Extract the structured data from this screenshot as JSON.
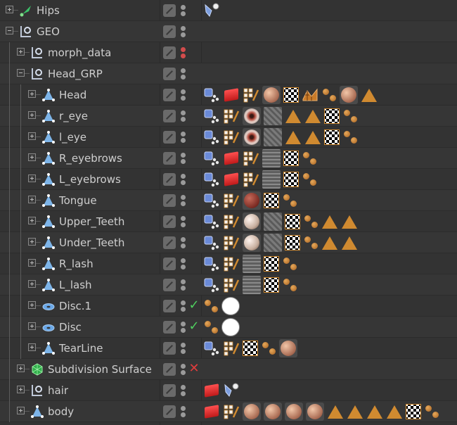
{
  "panel": "object-manager",
  "rows": [
    {
      "label": "Hips",
      "icon": "joint-icon",
      "depth": 0,
      "expander": "plus",
      "vis": "gray",
      "status": "",
      "tags": [
        "pose-morph-tag"
      ]
    },
    {
      "label": "GEO",
      "icon": "null-object-icon",
      "depth": 0,
      "expander": "minus",
      "vis": "gray",
      "status": "",
      "tags": []
    },
    {
      "label": "morph_data",
      "icon": "null-object-icon",
      "depth": 1,
      "expander": "plus",
      "vis": "red",
      "status": "",
      "tags": []
    },
    {
      "label": "Head_GRP",
      "icon": "null-object-icon",
      "depth": 1,
      "expander": "minus",
      "vis": "gray",
      "status": "",
      "tags": []
    },
    {
      "label": "Head",
      "icon": "polygon-object-icon",
      "depth": 2,
      "expander": "plus",
      "vis": "gray",
      "status": "",
      "tags": [
        "xpresso-tag",
        "selection-tag",
        "uvw-tag",
        "material-skin",
        "material-checker",
        "weight-tag",
        "dots-tag",
        "material-skin",
        "triangle-tag"
      ]
    },
    {
      "label": "r_eye",
      "icon": "polygon-object-icon",
      "depth": 2,
      "expander": "plus",
      "vis": "gray",
      "status": "",
      "tags": [
        "xpresso-tag",
        "uvw-tag",
        "material-eye",
        "material-tex",
        "triangle-tag",
        "triangle-tag",
        "material-checker",
        "dots-tag"
      ]
    },
    {
      "label": "l_eye",
      "icon": "polygon-object-icon",
      "depth": 2,
      "expander": "plus",
      "vis": "gray",
      "status": "",
      "tags": [
        "xpresso-tag",
        "uvw-tag",
        "material-eye",
        "material-tex",
        "triangle-tag",
        "triangle-tag",
        "material-checker",
        "dots-tag"
      ]
    },
    {
      "label": "R_eyebrows",
      "icon": "polygon-object-icon",
      "depth": 2,
      "expander": "plus",
      "vis": "gray",
      "status": "",
      "tags": [
        "xpresso-tag",
        "selection-tag",
        "uvw-tag",
        "material-tex2",
        "material-checker",
        "dots-tag"
      ]
    },
    {
      "label": "L_eyebrows",
      "icon": "polygon-object-icon",
      "depth": 2,
      "expander": "plus",
      "vis": "gray",
      "status": "",
      "tags": [
        "xpresso-tag",
        "selection-tag",
        "uvw-tag",
        "material-tex2",
        "material-checker",
        "dots-tag"
      ]
    },
    {
      "label": "Tongue",
      "icon": "polygon-object-icon",
      "depth": 2,
      "expander": "plus",
      "vis": "gray",
      "status": "",
      "tags": [
        "xpresso-tag",
        "uvw-tag",
        "material-red",
        "material-checker",
        "dots-tag"
      ]
    },
    {
      "label": "Upper_Teeth",
      "icon": "polygon-object-icon",
      "depth": 2,
      "expander": "plus",
      "vis": "gray",
      "status": "",
      "tags": [
        "xpresso-tag",
        "uvw-tag",
        "material-teeth",
        "material-tex",
        "material-checker",
        "dots-tag",
        "triangle-tag",
        "triangle-tag"
      ]
    },
    {
      "label": "Under_Teeth",
      "icon": "polygon-object-icon",
      "depth": 2,
      "expander": "plus",
      "vis": "gray",
      "status": "",
      "tags": [
        "xpresso-tag",
        "uvw-tag",
        "material-teeth",
        "material-tex",
        "material-checker",
        "dots-tag",
        "triangle-tag",
        "triangle-tag"
      ]
    },
    {
      "label": "R_lash",
      "icon": "polygon-object-icon",
      "depth": 2,
      "expander": "plus",
      "vis": "gray",
      "status": "",
      "tags": [
        "xpresso-tag",
        "uvw-tag",
        "material-tex2",
        "material-checker",
        "dots-tag"
      ]
    },
    {
      "label": "L_lash",
      "icon": "polygon-object-icon",
      "depth": 2,
      "expander": "plus",
      "vis": "gray",
      "status": "",
      "tags": [
        "xpresso-tag",
        "uvw-tag",
        "material-tex2",
        "material-checker",
        "dots-tag"
      ]
    },
    {
      "label": "Disc.1",
      "icon": "disc-icon",
      "depth": 2,
      "expander": "plus",
      "vis": "gray",
      "status": "check",
      "tags": [
        "dots-tag",
        "material-white"
      ]
    },
    {
      "label": "Disc",
      "icon": "disc-icon",
      "depth": 2,
      "expander": "plus",
      "vis": "gray",
      "status": "check",
      "tags": [
        "dots-tag",
        "material-white"
      ]
    },
    {
      "label": "TearLine",
      "icon": "polygon-object-icon",
      "depth": 2,
      "expander": "plus",
      "vis": "gray",
      "status": "",
      "tags": [
        "xpresso-tag",
        "uvw-tag",
        "material-checker",
        "dots-tag",
        "material-skin"
      ]
    },
    {
      "label": "Subdivision Surface",
      "icon": "subdivision-surface-icon",
      "depth": 1,
      "expander": "plus",
      "vis": "gray",
      "status": "x",
      "tags": []
    },
    {
      "label": "hair",
      "icon": "null-object-icon",
      "depth": 1,
      "expander": "plus",
      "vis": "gray",
      "status": "",
      "tags": [
        "selection-tag",
        "pose-morph-tag"
      ]
    },
    {
      "label": "body",
      "icon": "polygon-object-icon",
      "depth": 1,
      "expander": "plus",
      "vis": "gray",
      "status": "",
      "tags": [
        "selection-tag",
        "uvw-tag",
        "material-skin",
        "material-skin",
        "material-skin",
        "material-skin",
        "triangle-tag",
        "triangle-tag",
        "triangle-tag",
        "triangle-tag",
        "material-checker",
        "dots-tag"
      ]
    }
  ],
  "colors": {
    "background": "#333333",
    "row_alt": "#363636",
    "text": "#cfcfcf",
    "tag_orange": "#d08a30",
    "check_green": "#4fcf5f",
    "x_red": "#e03c3c",
    "dot_red": "#d24c4c"
  }
}
